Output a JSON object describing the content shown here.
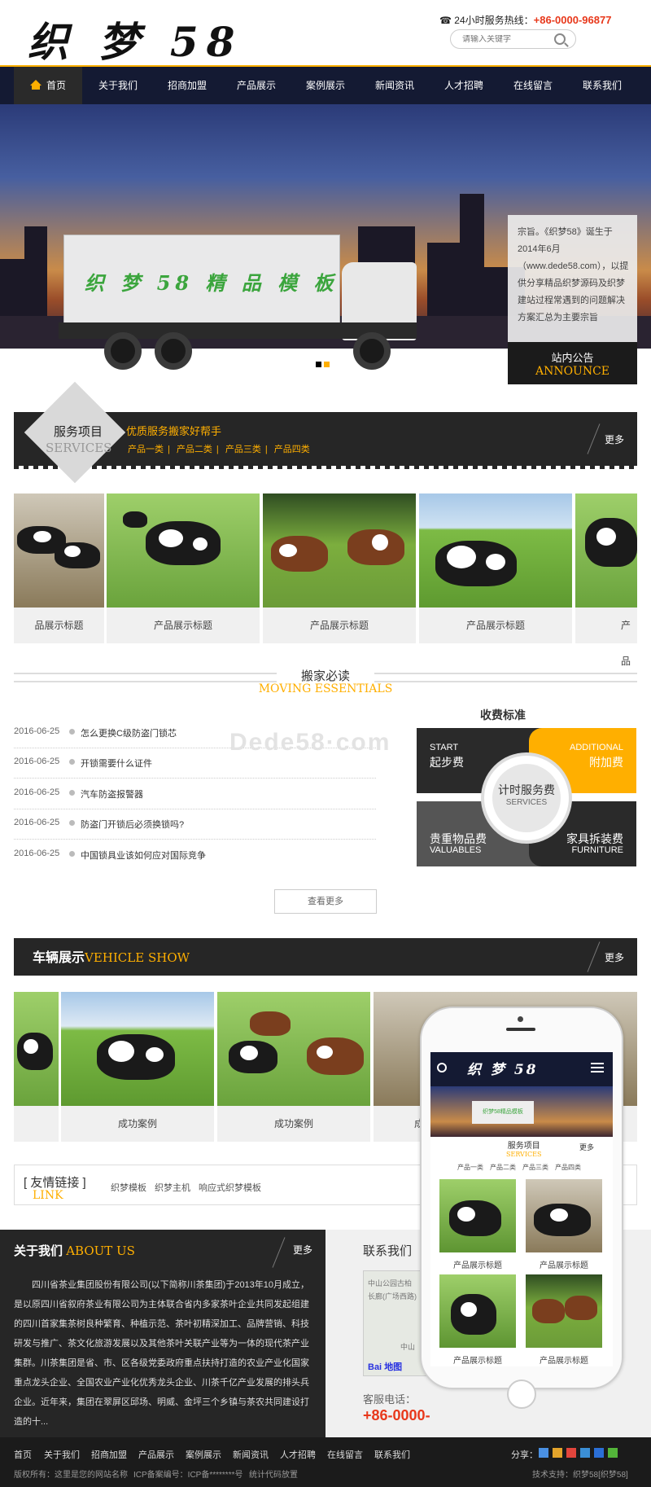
{
  "header": {
    "logo": "织 梦 58",
    "hotline_label": "24小时服务热线：",
    "hotline_number": "+86-0000-96877",
    "search_placeholder": "请输入关键字"
  },
  "nav": {
    "items": [
      "首页",
      "关于我们",
      "招商加盟",
      "产品展示",
      "案例展示",
      "新闻资讯",
      "人才招聘",
      "在线留言",
      "联系我们"
    ]
  },
  "banner": {
    "truck_text": "织 梦 58 精 品 模 板",
    "announce_text": "宗旨。《织梦58》诞生于2014年6月（www.dede58.com），以提供分享精品织梦源码及织梦建站过程常遇到的问题解决方案汇总为主要宗旨",
    "announce_title": "站内公告",
    "announce_sub": "ANNOUNCE"
  },
  "services": {
    "title": "服务项目",
    "sub": "SERVICES",
    "slogan": "优质服务搬家好帮手",
    "cats": [
      "产品一类",
      "产品二类",
      "产品三类",
      "产品四类"
    ],
    "more": "更多",
    "products": [
      "品展示标题",
      "产品展示标题",
      "产品展示标题",
      "产品展示标题",
      "产品"
    ]
  },
  "moving": {
    "title": "搬家必读",
    "sub": "MOVING ESSENTIALS",
    "news": [
      {
        "date": "2016-06-25",
        "title": "怎么更换C级防盗门锁芯"
      },
      {
        "date": "2016-06-25",
        "title": "开锁需要什么证件"
      },
      {
        "date": "2016-06-25",
        "title": "汽车防盗报警器"
      },
      {
        "date": "2016-06-25",
        "title": "防盗门开锁后必须换锁吗?"
      },
      {
        "date": "2016-06-25",
        "title": "中国锁具业该如何应对国际竞争"
      }
    ],
    "watermark": "Dede58·com",
    "view_more": "查看更多"
  },
  "fees": {
    "title": "收费标准",
    "start_en": "START",
    "start_zh": "起步费",
    "additional_en": "ADDITIONAL",
    "additional_zh": "附加费",
    "valuables_zh": "贵重物品费",
    "valuables_en": "VALUABLES",
    "furniture_zh": "家具拆装费",
    "furniture_en": "FURNITURE",
    "center_zh": "计时服务费",
    "center_en": "SERVICES"
  },
  "vehicle": {
    "title": "车辆展示",
    "sub": "VEHICLE SHOW",
    "more": "更多",
    "cases": [
      "",
      "成功案例",
      "成功案例",
      "成功案例"
    ]
  },
  "links": {
    "title": "[ 友情链接 ]",
    "sub": "LINK",
    "items": [
      "织梦模板",
      "织梦主机",
      "响应式织梦模板"
    ]
  },
  "about": {
    "title": "关于我们",
    "sub": "ABOUT US",
    "more": "更多",
    "text": "四川省茶业集团股份有限公司(以下简称川茶集团)于2013年10月成立，是以原四川省叙府茶业有限公司为主体联合省内多家茶叶企业共同发起组建的四川首家集茶树良种繁育、种植示范、茶叶初精深加工、品牌营销、科技研发与推广、茶文化旅游发展以及其他茶叶关联产业等为一体的现代茶产业集群。川茶集团是省、市、区各级党委政府重点扶持打造的农业产业化国家重点龙头企业、全国农业产业化优秀龙头企业、川茶千亿产业发展的排头兵企业。近年来，集团在翠屏区邱场、明威、金坪三个乡镇与茶农共同建设打造的十..."
  },
  "contact": {
    "title": "联系我们",
    "map_lines": [
      "中山公园古柏",
      "长廊(广场西路)",
      "中山"
    ],
    "baidu": "Bai",
    "baidu2": "地图",
    "phone_label": "客服电话：",
    "phone": "+86-0000-"
  },
  "mobile": {
    "logo": "织 梦 58",
    "truck_text": "织梦58精品模板",
    "svc_title": "服务项目",
    "svc_sub": "SERVICES",
    "more": "更多",
    "cats": "产品一类　产品二类　产品三类　产品四类",
    "captions": [
      "产品展示标题",
      "产品展示标题",
      "产品展示标题",
      "产品展示标题"
    ]
  },
  "footer": {
    "nav": [
      "首页",
      "关于我们",
      "招商加盟",
      "产品展示",
      "案例展示",
      "新闻资讯",
      "人才招聘",
      "在线留言",
      "联系我们"
    ],
    "share_label": "分享：",
    "copyright": "版权所有：这里是您的网站名称",
    "icp": "ICP备案编号：ICP备********号",
    "stats": "统计代码放置",
    "support": "技术支持：织梦58[织梦58]"
  },
  "colors": {
    "accent": "#ffaf00",
    "nav_bg": "#141a33",
    "dark": "#262626",
    "phone_red": "#e8381b"
  }
}
